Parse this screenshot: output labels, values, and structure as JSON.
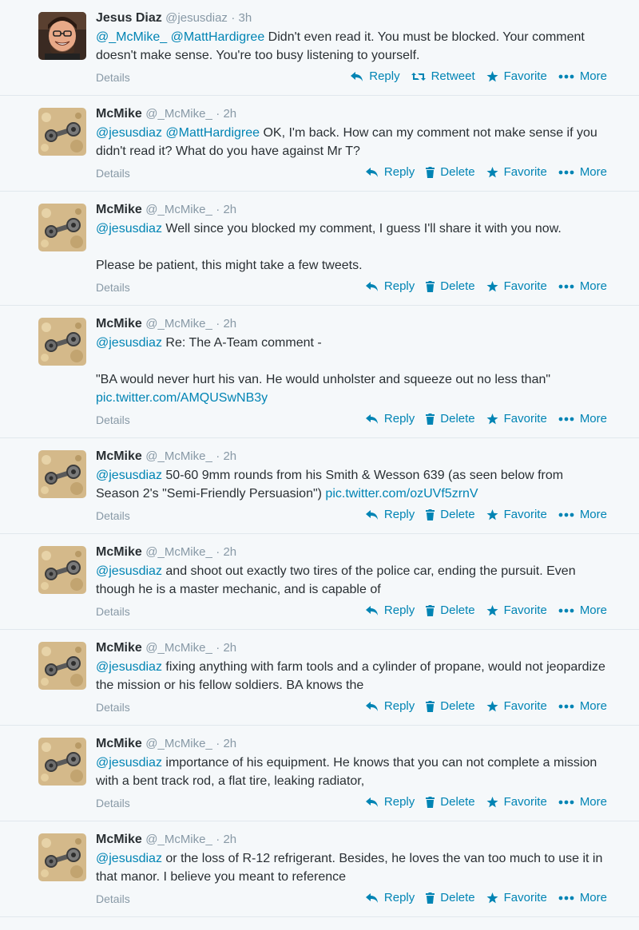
{
  "actions": {
    "details": "Details",
    "reply": "Reply",
    "retweet": "Retweet",
    "delete": "Delete",
    "favorite": "Favorite",
    "more": "More"
  },
  "tweets": [
    {
      "name": "Jesus Diaz",
      "handle": "@jesusdiaz",
      "time": "· 3h",
      "avatar": "jesus",
      "own": false,
      "segments": [
        {
          "type": "link",
          "text": "@_McMike_"
        },
        {
          "type": "text",
          "text": " "
        },
        {
          "type": "link",
          "text": "@MattHardigree"
        },
        {
          "type": "text",
          "text": " Didn't even read it. You must be blocked. Your comment doesn't make sense. You're too busy listening to yourself."
        }
      ]
    },
    {
      "name": "McMike",
      "handle": "@_McMike_",
      "time": "· 2h",
      "avatar": "mcmike",
      "own": true,
      "segments": [
        {
          "type": "link",
          "text": "@jesusdiaz"
        },
        {
          "type": "text",
          "text": " "
        },
        {
          "type": "link",
          "text": "@MattHardigree"
        },
        {
          "type": "text",
          "text": " OK, I'm back.   How can my comment not make sense if you didn't read it?  What do you have against Mr T?"
        }
      ]
    },
    {
      "name": "McMike",
      "handle": "@_McMike_",
      "time": "· 2h",
      "avatar": "mcmike",
      "own": true,
      "segments": [
        {
          "type": "link",
          "text": "@jesusdiaz"
        },
        {
          "type": "text",
          "text": " Well since you blocked my comment, I guess I'll share it with you now.\n\nPlease be patient,  this might take a few tweets."
        }
      ]
    },
    {
      "name": "McMike",
      "handle": "@_McMike_",
      "time": "· 2h",
      "avatar": "mcmike",
      "own": true,
      "segments": [
        {
          "type": "link",
          "text": "@jesusdiaz"
        },
        {
          "type": "text",
          "text": " Re: The A-Team comment -\n\n\"BA would never hurt his van. He would unholster and squeeze out no less than\" "
        },
        {
          "type": "link",
          "text": "pic.twitter.com/AMQUSwNB3y"
        }
      ]
    },
    {
      "name": "McMike",
      "handle": "@_McMike_",
      "time": "· 2h",
      "avatar": "mcmike",
      "own": true,
      "segments": [
        {
          "type": "link",
          "text": "@jesusdiaz"
        },
        {
          "type": "text",
          "text": " 50-60 9mm rounds from his Smith & Wesson 639 (as seen below from Season 2's \"Semi-Friendly Persuasion\") "
        },
        {
          "type": "link",
          "text": "pic.twitter.com/ozUVf5zrnV"
        }
      ]
    },
    {
      "name": "McMike",
      "handle": "@_McMike_",
      "time": "· 2h",
      "avatar": "mcmike",
      "own": true,
      "segments": [
        {
          "type": "link",
          "text": "@jesusdiaz"
        },
        {
          "type": "text",
          "text": " and shoot out exactly two tires of the police car, ending the pursuit. Even though he is a master mechanic, and is capable of"
        }
      ]
    },
    {
      "name": "McMike",
      "handle": "@_McMike_",
      "time": "· 2h",
      "avatar": "mcmike",
      "own": true,
      "segments": [
        {
          "type": "link",
          "text": "@jesusdiaz"
        },
        {
          "type": "text",
          "text": " fixing anything with farm tools and a cylinder of propane, would not jeopardize the mission or his fellow soldiers. BA knows the"
        }
      ]
    },
    {
      "name": "McMike",
      "handle": "@_McMike_",
      "time": "· 2h",
      "avatar": "mcmike",
      "own": true,
      "segments": [
        {
          "type": "link",
          "text": "@jesusdiaz"
        },
        {
          "type": "text",
          "text": " importance of his equipment. He knows that you can not complete a mission with a bent track rod, a flat tire, leaking radiator,"
        }
      ]
    },
    {
      "name": "McMike",
      "handle": "@_McMike_",
      "time": "· 2h",
      "avatar": "mcmike",
      "own": true,
      "segments": [
        {
          "type": "link",
          "text": "@jesusdiaz"
        },
        {
          "type": "text",
          "text": " or the loss of R-12 refrigerant. Besides, he loves the van too much to use it in that manor.  I believe you meant to reference"
        }
      ]
    }
  ]
}
